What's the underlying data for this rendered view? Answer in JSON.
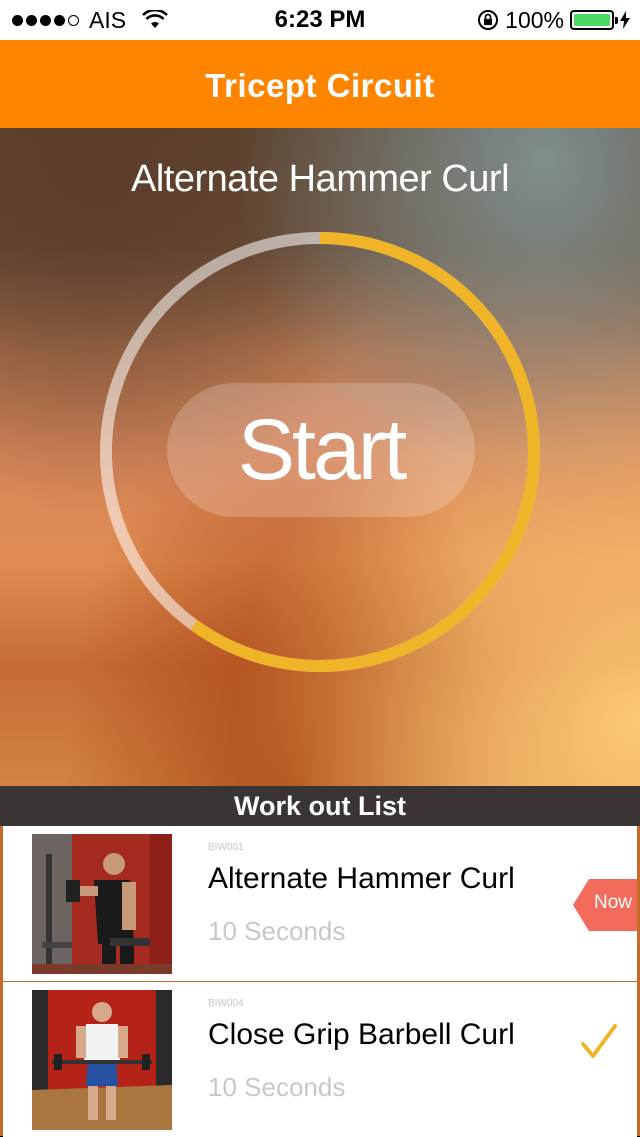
{
  "status_bar": {
    "carrier": "AIS",
    "time": "6:23 PM",
    "battery_percent": "100%",
    "signal_bars": 4,
    "icons": [
      "signal-dots-icon",
      "wifi-icon",
      "rotation-lock-icon",
      "battery-icon",
      "charging-bolt-icon"
    ]
  },
  "header": {
    "title": "Tricept  Circuit"
  },
  "hero": {
    "exercise_title": "Alternate Hammer Curl",
    "start_label": "Start",
    "progress_fraction": 0.6,
    "ring_color": "#f0b429",
    "ring_track_color": "rgba(255,255,255,0.55)"
  },
  "workout_list": {
    "title": "Work out List",
    "items": [
      {
        "code": "BIW001",
        "name": "Alternate Hammer Curl",
        "duration": "10 Seconds",
        "badge": "Now",
        "thumbnail": "man-dumbbell-curl-photo"
      },
      {
        "code": "BIW004",
        "name": "Close Grip Barbell Curl",
        "duration": "10 Seconds",
        "badge": "completed-check",
        "thumbnail": "man-barbell-curl-photo"
      }
    ]
  },
  "colors": {
    "header_orange": "#ff8400",
    "list_header": "#3a3534",
    "now_badge": "#f26b5b",
    "check": "#f0b429"
  }
}
